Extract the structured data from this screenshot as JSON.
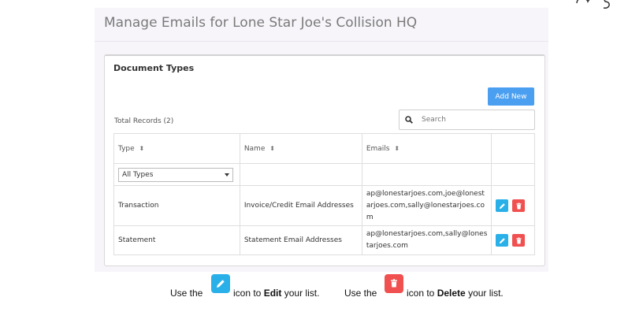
{
  "page": {
    "title": "Manage Emails for Lone Star Joe's Collision HQ"
  },
  "panel": {
    "title": "Document Types",
    "add_label": "Add New",
    "total_label": "Total Records (2)",
    "search_placeholder": "Search"
  },
  "table": {
    "columns": [
      "Type",
      "Name",
      "Emails"
    ],
    "filter_selected": "All Types",
    "rows": [
      {
        "type": "Transaction",
        "name": "Invoice/Credit Email Addresses",
        "emails": [
          "ap@lonestarjoes.com,joe@lonest",
          "arjoes.com,sally@lonestarjoes.co",
          "m"
        ]
      },
      {
        "type": "Statement",
        "name": "Statement Email Addresses",
        "emails": [
          "ap@lonestarjoes.com,sally@lones",
          "tarjoes.com"
        ]
      }
    ]
  },
  "caption": {
    "edit_prefix": "Use the",
    "edit_middle": "icon to",
    "edit_word": "Edit",
    "edit_suffix": "your list.",
    "delete_prefix": "Use the",
    "delete_middle": "icon to",
    "delete_word": "Delete",
    "delete_suffix": "your list."
  },
  "colors": {
    "accent": "#4a9ff0",
    "edit": "#2ab0e8",
    "delete": "#f05050"
  },
  "icons": [
    "search-icon",
    "sort-icon",
    "chevron-down-icon",
    "pencil-icon",
    "trash-icon"
  ]
}
